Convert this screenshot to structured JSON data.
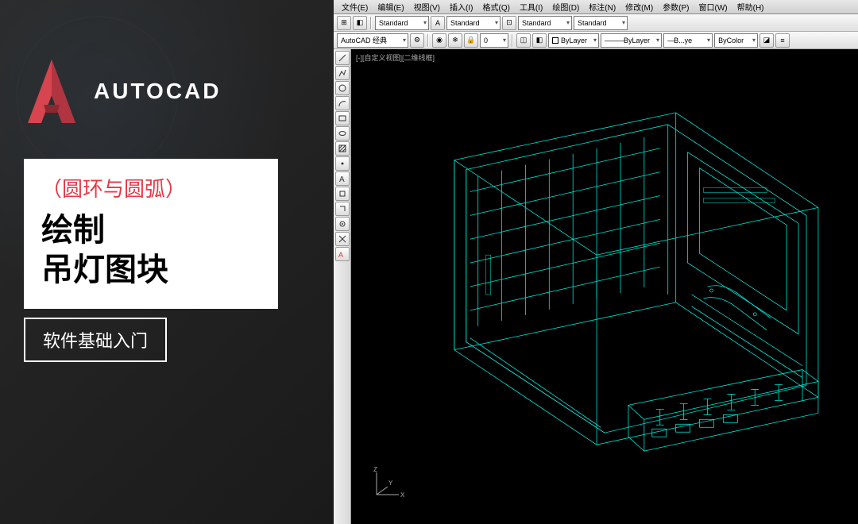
{
  "promo": {
    "brand": "AUTOCAD",
    "subtitle": "（圆环与圆弧）",
    "title_line1": "绘制",
    "title_line2": "吊灯图块",
    "tag": "软件基础入门"
  },
  "menubar": {
    "items": [
      "文件(E)",
      "编辑(E)",
      "视图(V)",
      "插入(I)",
      "格式(Q)",
      "工具(I)",
      "绘图(D)",
      "标注(N)",
      "修改(M)",
      "参数(P)",
      "窗口(W)",
      "帮助(H)"
    ]
  },
  "toolbar1": {
    "style_dropdowns": [
      "Standard",
      "Standard",
      "Standard",
      "Standard"
    ]
  },
  "toolbar2": {
    "workspace": "AutoCAD 经典",
    "layer": "0",
    "color": "ByLayer",
    "linetype": "ByLayer",
    "lineweight": "B...ye",
    "plotcolor": "ByColor"
  },
  "viewport": {
    "label": "[-][自定义视图][二维线框]"
  },
  "ucs": {
    "x": "X",
    "y": "Y",
    "z": "Z"
  },
  "colors": {
    "accent_red": "#e63946",
    "cad_cyan": "#00e5d8",
    "cad_bg": "#000000"
  }
}
